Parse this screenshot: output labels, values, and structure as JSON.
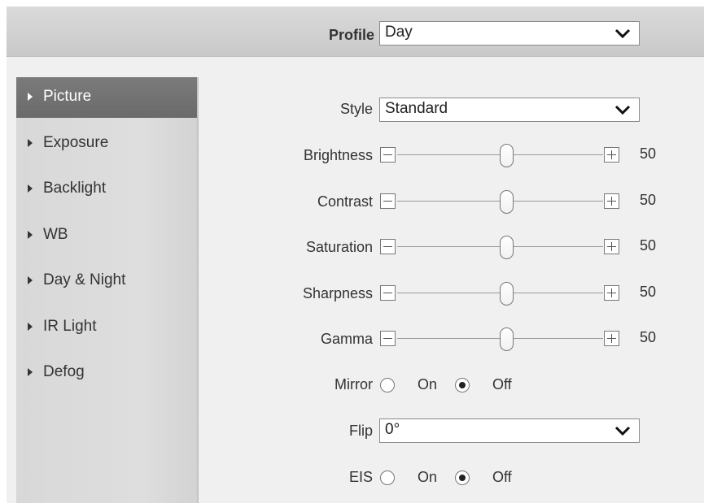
{
  "header": {
    "profile_label": "Profile",
    "profile_value": "Day"
  },
  "sidebar": {
    "items": [
      {
        "label": "Picture",
        "active": true
      },
      {
        "label": "Exposure"
      },
      {
        "label": "Backlight"
      },
      {
        "label": "WB"
      },
      {
        "label": "Day & Night"
      },
      {
        "label": "IR Light"
      },
      {
        "label": "Defog"
      }
    ]
  },
  "form": {
    "style": {
      "label": "Style",
      "value": "Standard"
    },
    "sliders": [
      {
        "label": "Brightness",
        "value": "50"
      },
      {
        "label": "Contrast",
        "value": "50"
      },
      {
        "label": "Saturation",
        "value": "50"
      },
      {
        "label": "Sharpness",
        "value": "50"
      },
      {
        "label": "Gamma",
        "value": "50"
      }
    ],
    "mirror": {
      "label": "Mirror",
      "on_label": "On",
      "off_label": "Off",
      "selected": "Off"
    },
    "flip": {
      "label": "Flip",
      "value": "0°"
    },
    "eis": {
      "label": "EIS",
      "on_label": "On",
      "off_label": "Off",
      "selected": "Off"
    }
  },
  "icons": {
    "nav_arrow": "triangle-right-icon",
    "dropdown": "chevron-down-icon",
    "decrease": "minus-icon",
    "increase": "plus-icon"
  },
  "colors": {
    "header_bg": "#cfcfcf",
    "sidebar_bg": "#dadada",
    "active_item_bg": "#717171",
    "panel_bg": "#f0f0f0"
  }
}
